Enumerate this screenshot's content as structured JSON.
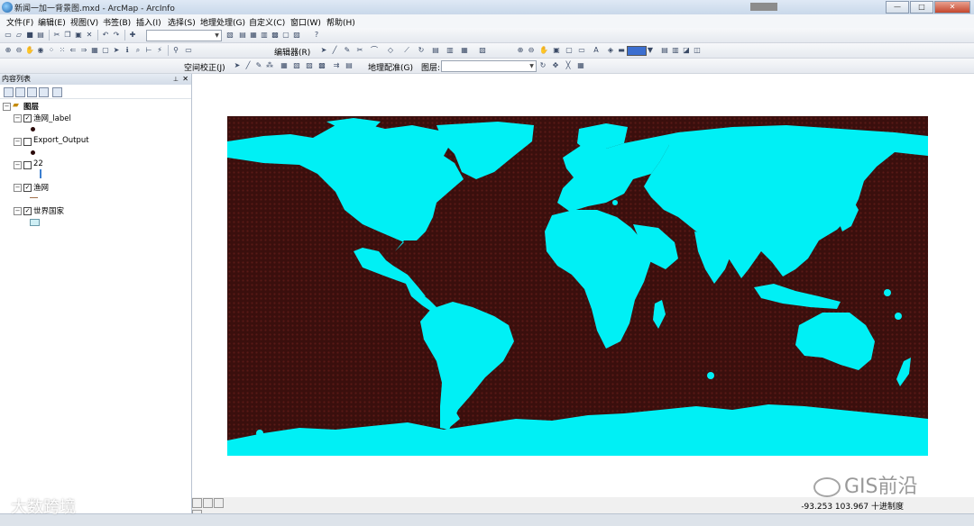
{
  "window": {
    "title": "新闻一加一背景图.mxd - ArcMap - ArcInfo",
    "controls": {
      "minimize": "—",
      "maximize": "□",
      "close": "✕"
    }
  },
  "menubar": {
    "items": [
      "文件(F)",
      "编辑(E)",
      "视图(V)",
      "书签(B)",
      "插入(I)",
      "选择(S)",
      "地理处理(G)",
      "自定义(C)",
      "窗口(W)",
      "帮助(H)"
    ]
  },
  "toolbar": {
    "editor_label": "编辑器(R)",
    "spatial_adjust_label": "空间校正(J)",
    "georef_label": "地理配准(G)",
    "layer_label": "图层:",
    "layer_combo_value": "",
    "scale_combo_value": ""
  },
  "toc": {
    "title": "内容列表",
    "pin": "⊥",
    "close": "✕",
    "group_label": "图层",
    "layers": [
      {
        "name": "渔网_label",
        "checked": true
      },
      {
        "name": "Export_Output",
        "checked": false
      },
      {
        "name": "22",
        "checked": false
      },
      {
        "name": "渔网",
        "checked": true
      },
      {
        "name": "世界国家",
        "checked": true
      }
    ]
  },
  "map": {
    "background_color": "#3a0f0d",
    "land_color": "#00f0f5"
  },
  "status": {
    "coordinates": "-93.253  103.967 十进制度"
  },
  "watermarks": {
    "left": "大数跨境",
    "right": "GIS前沿"
  }
}
